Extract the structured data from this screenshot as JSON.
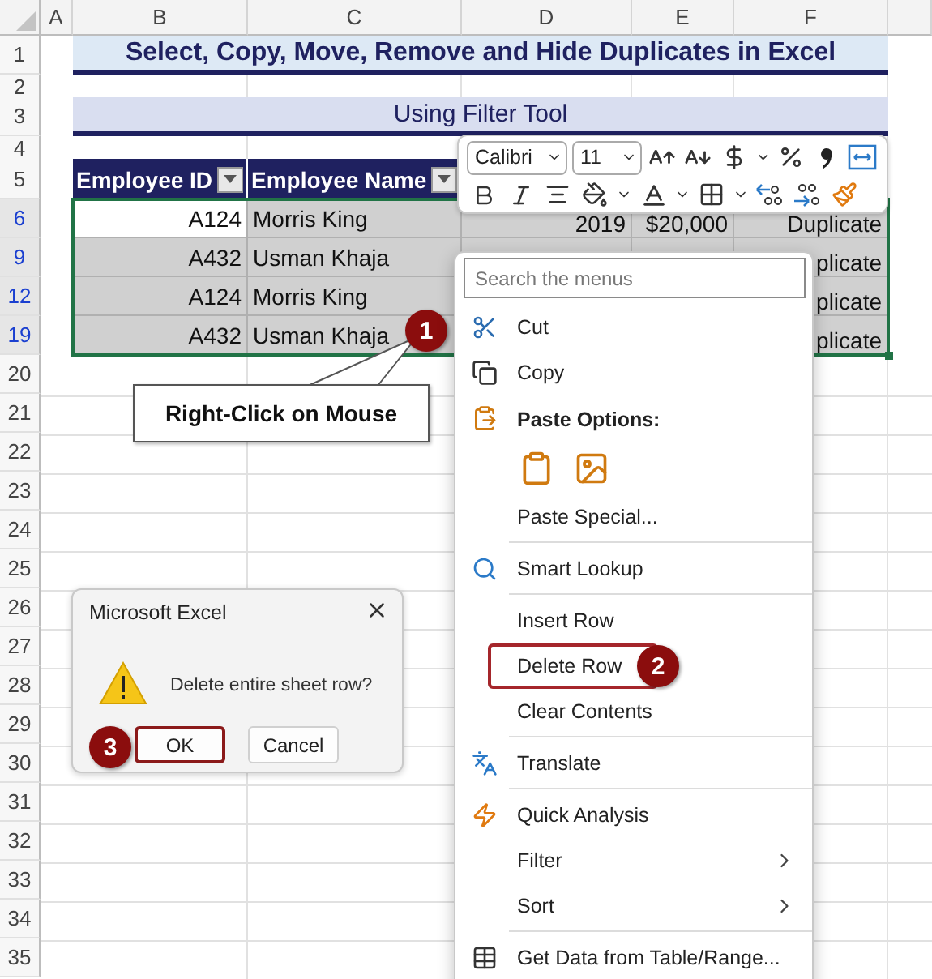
{
  "columns": [
    "A",
    "B",
    "C",
    "D",
    "E",
    "F"
  ],
  "top_rows": [
    "1",
    "2",
    "3",
    "4",
    "5"
  ],
  "title": "Select, Copy, Move, Remove and Hide Duplicates in Excel",
  "subtitle": "Using Filter Tool",
  "table": {
    "headers": [
      "Employee ID",
      "Employee Name"
    ],
    "rows": [
      {
        "row_number": "6",
        "active": true,
        "id": "A124",
        "name": "Morris King",
        "column_d": "2019",
        "column_e": "$20,000",
        "column_f": "Duplicate"
      },
      {
        "row_number": "9",
        "active": false,
        "id": "A432",
        "name": "Usman Khaja",
        "column_f": "plicate"
      },
      {
        "row_number": "12",
        "active": false,
        "id": "A124",
        "name": "Morris King",
        "column_f": "plicate"
      },
      {
        "row_number": "19",
        "active": false,
        "id": "A432",
        "name": "Usman Khaja",
        "column_f": "plicate"
      }
    ]
  },
  "bottom_rows": [
    "20",
    "21",
    "22",
    "23",
    "24",
    "25",
    "26",
    "27",
    "28",
    "29",
    "30",
    "31",
    "32",
    "33",
    "34",
    "35"
  ],
  "format_toolbar": {
    "font": "Calibri",
    "size": "11"
  },
  "callout": {
    "text": "Right-Click on Mouse",
    "step": "1"
  },
  "context_menu": {
    "items": [
      {
        "kind": "search",
        "placeholder": "Search the menus"
      },
      {
        "kind": "item",
        "label": "Cut",
        "highlighted": false,
        "submenu": false
      },
      {
        "kind": "item",
        "label": "Copy",
        "highlighted": false,
        "submenu": false
      },
      {
        "kind": "heading",
        "label": "Paste Options:"
      },
      {
        "kind": "paste_icons"
      },
      {
        "kind": "item",
        "label": "Paste Special...",
        "highlighted": false,
        "submenu": false
      },
      {
        "kind": "separator"
      },
      {
        "kind": "item",
        "label": "Smart Lookup",
        "highlighted": false,
        "submenu": false
      },
      {
        "kind": "separator"
      },
      {
        "kind": "item",
        "label": "Insert Row",
        "highlighted": false,
        "submenu": false
      },
      {
        "kind": "item",
        "label": "Delete Row",
        "highlighted": true,
        "step": "2",
        "submenu": false
      },
      {
        "kind": "item",
        "label": "Clear Contents",
        "highlighted": false,
        "submenu": false
      },
      {
        "kind": "separator"
      },
      {
        "kind": "item",
        "label": "Translate",
        "highlighted": false,
        "submenu": false
      },
      {
        "kind": "separator"
      },
      {
        "kind": "item",
        "label": "Quick Analysis",
        "highlighted": false,
        "submenu": false
      },
      {
        "kind": "item",
        "label": "Filter",
        "highlighted": false,
        "submenu": true
      },
      {
        "kind": "item",
        "label": "Sort",
        "highlighted": false,
        "submenu": true
      },
      {
        "kind": "separator"
      },
      {
        "kind": "item",
        "label": "Get Data from Table/Range...",
        "highlighted": false,
        "submenu": false
      }
    ]
  },
  "dialog": {
    "title": "Microsoft Excel",
    "message": "Delete entire sheet row?",
    "step": "3",
    "buttons": [
      {
        "label": "OK",
        "highlighted": true
      },
      {
        "label": "Cancel",
        "highlighted": false
      }
    ]
  }
}
